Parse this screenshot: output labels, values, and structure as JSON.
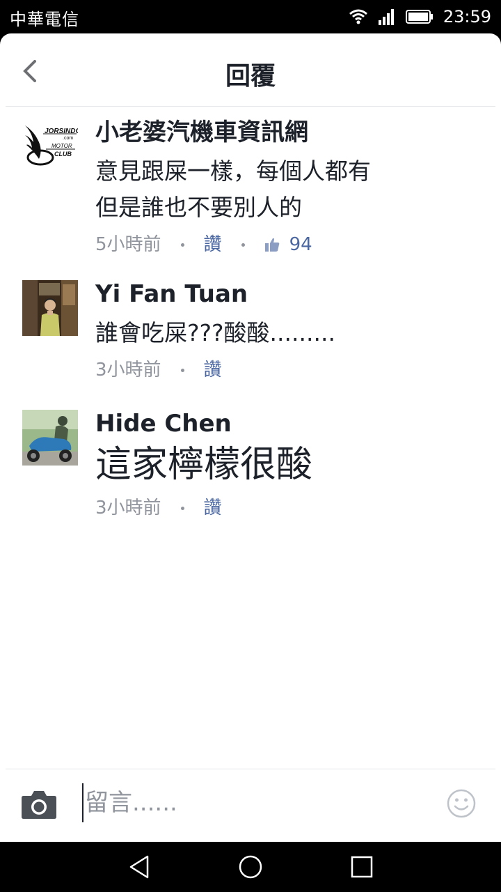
{
  "status_bar": {
    "carrier": "中華電信",
    "time": "23:59"
  },
  "header": {
    "title": "回覆"
  },
  "comments": [
    {
      "name": "小老婆汽機車資訊網",
      "text_lines": [
        "意見跟屎一樣，每個人都有",
        "但是誰也不要別人的"
      ],
      "time": "5小時前",
      "like_label": "讚",
      "likes": "94",
      "avatar": "jorsindo-logo-avatar"
    },
    {
      "name": "Yi Fan Tuan",
      "text_lines": [
        "誰會吃屎???酸酸........."
      ],
      "time": "3小時前",
      "like_label": "讚",
      "avatar": "person-photo-avatar"
    },
    {
      "name": "Hide Chen",
      "text_lines": [
        "這家檸檬很酸"
      ],
      "time": "3小時前",
      "like_label": "讚",
      "avatar": "scooter-rider-avatar"
    }
  ],
  "composer": {
    "placeholder": "留言......"
  },
  "icons": {
    "back": "chevron-left-icon",
    "camera": "camera-icon",
    "emoji": "smiley-icon",
    "like": "thumbs-up-icon",
    "wifi": "wifi-icon",
    "signal": "signal-icon",
    "battery": "battery-icon"
  },
  "colors": {
    "link": "#4b67a1",
    "meta": "#90949c",
    "text": "#1d2129"
  }
}
